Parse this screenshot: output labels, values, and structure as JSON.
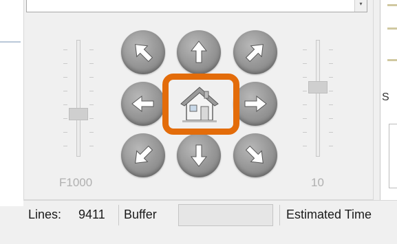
{
  "jog": {
    "buttons": [
      {
        "name": "jog-up-left-button",
        "icon": "arrow-up-left-icon"
      },
      {
        "name": "jog-up-button",
        "icon": "arrow-up-icon"
      },
      {
        "name": "jog-up-right-button",
        "icon": "arrow-up-right-icon"
      },
      {
        "name": "jog-left-button",
        "icon": "arrow-left-icon"
      },
      {
        "name": "jog-right-button",
        "icon": "arrow-right-icon"
      },
      {
        "name": "jog-down-left-button",
        "icon": "arrow-down-left-icon"
      },
      {
        "name": "jog-down-button",
        "icon": "arrow-down-icon"
      },
      {
        "name": "jog-down-right-button",
        "icon": "arrow-down-right-icon"
      }
    ],
    "home_icon": "home-icon",
    "highlight_color": "#e36c0a"
  },
  "feed_slider": {
    "label": "F1000"
  },
  "step_slider": {
    "label": "10"
  },
  "status": {
    "lines_label": "Lines:",
    "lines_value": "9411",
    "buffer_label": "Buffer",
    "estimated_label": "Estimated Time"
  },
  "right_panel": {
    "letter": "S"
  }
}
